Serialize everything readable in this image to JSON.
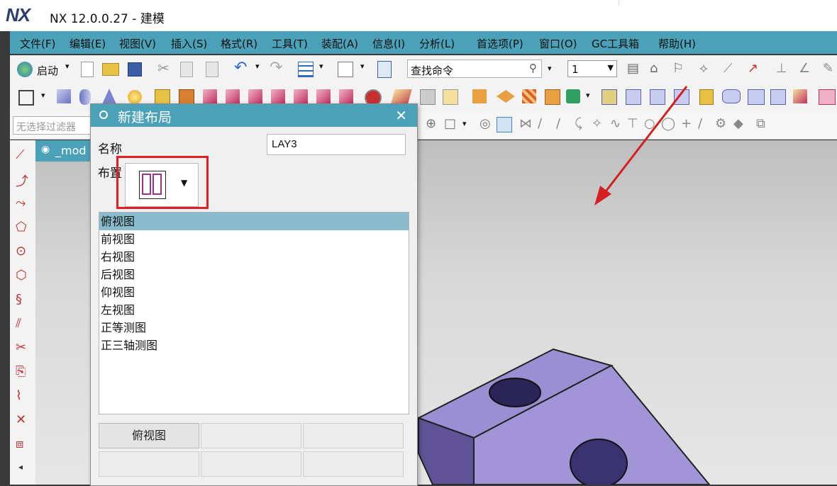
{
  "window": {
    "logo": "NX",
    "title": "NX 12.0.0.27 - 建模"
  },
  "menu": [
    "文件(F)",
    "编辑(E)",
    "视图(V)",
    "插入(S)",
    "格式(R)",
    "工具(T)",
    "装配(A)",
    "信息(I)",
    "分析(L)",
    "首选项(P)",
    "窗口(O)",
    "GC工具箱",
    "帮助(H)"
  ],
  "toolbar": {
    "start_label": "启动",
    "command_search_placeholder": "查找命令",
    "number_select_value": "1",
    "selection_filter_placeholder": "无选择过滤器"
  },
  "model_tab": {
    "label": "_mod"
  },
  "dialog": {
    "title": "新建布局",
    "name_label": "名称",
    "name_value": "LAY3",
    "layout_label": "布置",
    "views": [
      "俯视图",
      "前视图",
      "右视图",
      "后视图",
      "仰视图",
      "左视图",
      "正等测图",
      "正三轴测图"
    ],
    "selected_view": "俯视图",
    "grid_cells": [
      "俯视图",
      "",
      "",
      "",
      "",
      "",
      "",
      "",
      ""
    ]
  },
  "colors": {
    "accent": "#4aa1b8",
    "selection": "#88bccc",
    "highlight_box": "#e02020",
    "arrow": "#d42020",
    "model_face": "#a195d8",
    "model_dark": "#6b5ea4",
    "layout_icon": "#a03090"
  }
}
